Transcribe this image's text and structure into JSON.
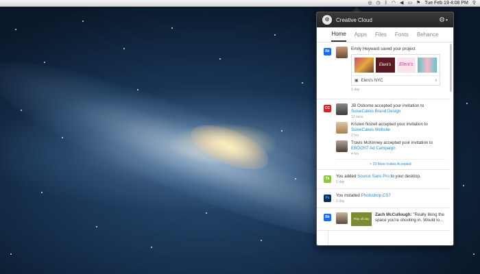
{
  "menubar": {
    "clock": "Tue Feb 19  4:08 PM",
    "icons": [
      "creative-cloud-icon",
      "time-machine-icon",
      "bluetooth-icon",
      "wifi-icon",
      "volume-icon",
      "battery-icon",
      "flag-icon",
      "spotlight-icon"
    ]
  },
  "panel": {
    "title": "Creative Cloud",
    "tabs": [
      {
        "label": "Home",
        "active": true
      },
      {
        "label": "Apps",
        "active": false
      },
      {
        "label": "Files",
        "active": false
      },
      {
        "label": "Fonts",
        "active": false
      },
      {
        "label": "Behance",
        "active": false
      }
    ]
  },
  "feed": {
    "behance_project": {
      "badge": "Bē",
      "message": "Emily Heyward saved your project",
      "project_name": "Eleni's NYC",
      "thumb_labels": [
        "Eleni's",
        "Eleni's"
      ],
      "time": "1 day"
    },
    "invites": {
      "badge": "CC",
      "entries": [
        {
          "text": "JB Osborne accepted your invitation to",
          "link": "SuiseCakes Brand Design",
          "time": "12 mins"
        },
        {
          "text": "Kristen Nozell accepted your invitation to",
          "link": "SuiseCakes Website",
          "time": "2 hrs"
        },
        {
          "text": "Travis McKinney accepted your invitation to",
          "link": "EBOOST Ad Campaign",
          "time": "4 hrs"
        }
      ],
      "more": "+ 23 More Invites Accepted"
    },
    "font": {
      "badge": "Tk",
      "prefix": "You added ",
      "link": "Source Sans Pro",
      "suffix": " to your desktop.",
      "time": "1 day"
    },
    "install": {
      "badge": "Ps",
      "prefix": "You installed ",
      "link": "Photoshop CS7",
      "time": "1 day"
    },
    "behance_comment": {
      "badge": "Bē",
      "thumb_label": "Play all day",
      "author": "Zach McCullough:",
      "quote": "\"Really liking the space you're shooting in. Would lo..."
    }
  }
}
